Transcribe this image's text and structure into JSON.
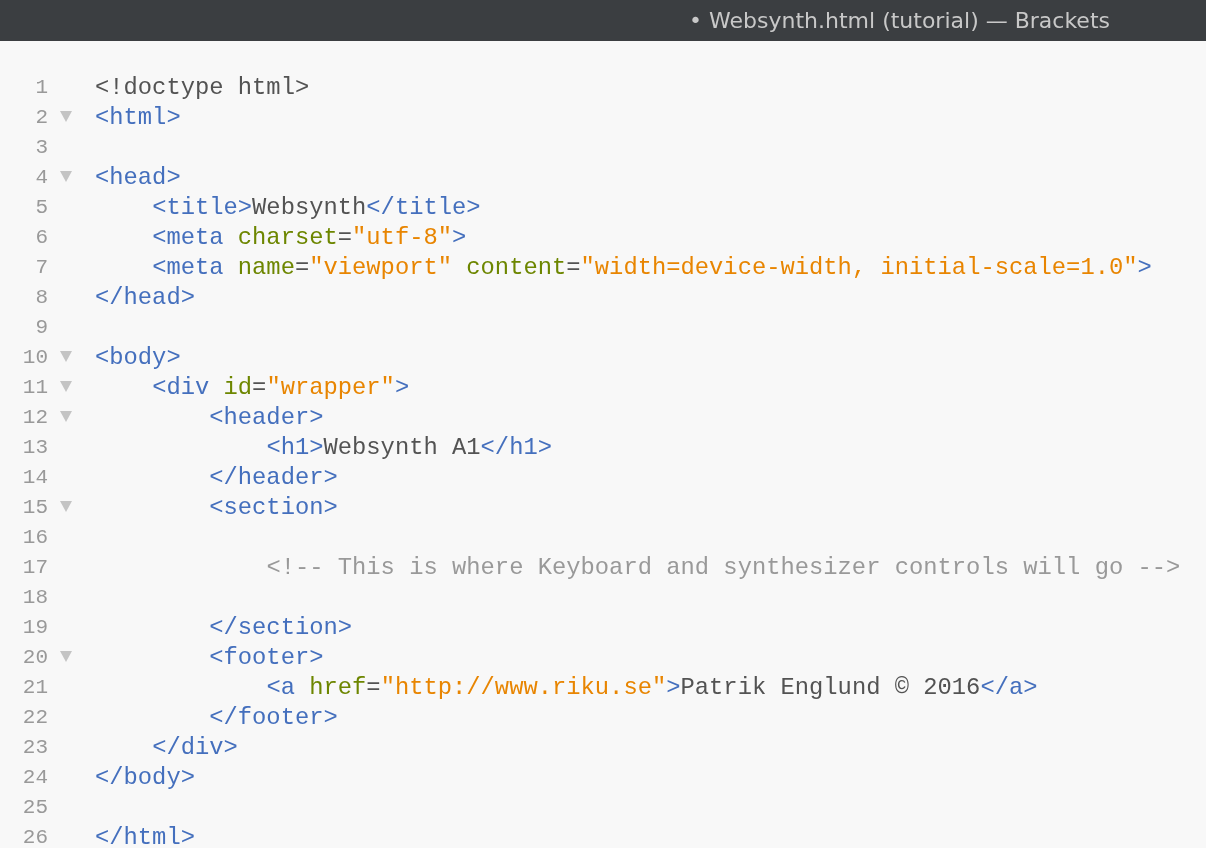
{
  "window": {
    "title": "• Websynth.html (tutorial) — Brackets"
  },
  "editor": {
    "lines": [
      {
        "number": "1",
        "tokens": [
          {
            "kind": "plain",
            "text": "<!doctype html>"
          }
        ]
      },
      {
        "number": "2",
        "expanded": true,
        "tokens": [
          {
            "kind": "tag",
            "text": "<html>"
          }
        ]
      },
      {
        "number": "3"
      },
      {
        "number": "4",
        "expanded": true,
        "tokens": [
          {
            "kind": "tag",
            "text": "<head>"
          }
        ]
      },
      {
        "number": "5",
        "tokens": [
          {
            "kind": "tag",
            "text": "    <title>"
          },
          {
            "kind": "plain",
            "text": "Websynth"
          },
          {
            "kind": "tag",
            "text": "</title>"
          }
        ]
      },
      {
        "number": "6",
        "tokens": [
          {
            "kind": "tag",
            "text": "    <meta "
          },
          {
            "kind": "attr",
            "text": "charset"
          },
          {
            "kind": "plain",
            "text": "="
          },
          {
            "kind": "string",
            "text": "\"utf-8\""
          },
          {
            "kind": "tag",
            "text": ">"
          }
        ]
      },
      {
        "number": "7",
        "tokens": [
          {
            "kind": "tag",
            "text": "    <meta "
          },
          {
            "kind": "attr",
            "text": "name"
          },
          {
            "kind": "plain",
            "text": "="
          },
          {
            "kind": "string",
            "text": "\"viewport\" "
          },
          {
            "kind": "attr",
            "text": "content"
          },
          {
            "kind": "plain",
            "text": "="
          },
          {
            "kind": "string",
            "text": "\"width=device-width, initial-scale=1.0\""
          },
          {
            "kind": "tag",
            "text": ">"
          }
        ]
      },
      {
        "number": "8",
        "tokens": [
          {
            "kind": "tag",
            "text": "</head>"
          }
        ]
      },
      {
        "number": "9"
      },
      {
        "number": "10",
        "expanded": true,
        "tokens": [
          {
            "kind": "tag",
            "text": "<body>"
          }
        ]
      },
      {
        "number": "11",
        "expanded": true,
        "tokens": [
          {
            "kind": "tag",
            "text": "    <div "
          },
          {
            "kind": "attr",
            "text": "id"
          },
          {
            "kind": "plain",
            "text": "="
          },
          {
            "kind": "string",
            "text": "\"wrapper\""
          },
          {
            "kind": "tag",
            "text": ">"
          }
        ]
      },
      {
        "number": "12",
        "expanded": true,
        "tokens": [
          {
            "kind": "tag",
            "text": "        <header>"
          }
        ]
      },
      {
        "number": "13",
        "tokens": [
          {
            "kind": "tag",
            "text": "            <h1>"
          },
          {
            "kind": "plain",
            "text": "Websynth A1"
          },
          {
            "kind": "tag",
            "text": "</h1>"
          }
        ]
      },
      {
        "number": "14",
        "tokens": [
          {
            "kind": "tag",
            "text": "        </header>"
          }
        ]
      },
      {
        "number": "15",
        "expanded": true,
        "tokens": [
          {
            "kind": "tag",
            "text": "        <section>"
          }
        ]
      },
      {
        "number": "16"
      },
      {
        "number": "17",
        "tokens": [
          {
            "kind": "comment",
            "text": "            <!-- This is where Keyboard and synthesizer controls will go -->"
          }
        ]
      },
      {
        "number": "18"
      },
      {
        "number": "19",
        "tokens": [
          {
            "kind": "tag",
            "text": "        </section>"
          }
        ]
      },
      {
        "number": "20",
        "expanded": true,
        "tokens": [
          {
            "kind": "tag",
            "text": "        <footer>"
          }
        ]
      },
      {
        "number": "21",
        "tokens": [
          {
            "kind": "tag",
            "text": "            <a "
          },
          {
            "kind": "attr",
            "text": "href"
          },
          {
            "kind": "plain",
            "text": "="
          },
          {
            "kind": "string",
            "text": "\"http://www.riku.se\""
          },
          {
            "kind": "tag",
            "text": ">"
          },
          {
            "kind": "plain",
            "text": "Patrik Englund © 2016"
          },
          {
            "kind": "tag",
            "text": "</a>"
          }
        ]
      },
      {
        "number": "22",
        "tokens": [
          {
            "kind": "tag",
            "text": "        </footer>"
          }
        ]
      },
      {
        "number": "23",
        "tokens": [
          {
            "kind": "tag",
            "text": "    </div>"
          }
        ]
      },
      {
        "number": "24",
        "tokens": [
          {
            "kind": "tag",
            "text": "</body>"
          }
        ]
      },
      {
        "number": "25"
      },
      {
        "number": "26",
        "tokens": [
          {
            "kind": "tag",
            "text": "</html>"
          }
        ]
      }
    ]
  }
}
